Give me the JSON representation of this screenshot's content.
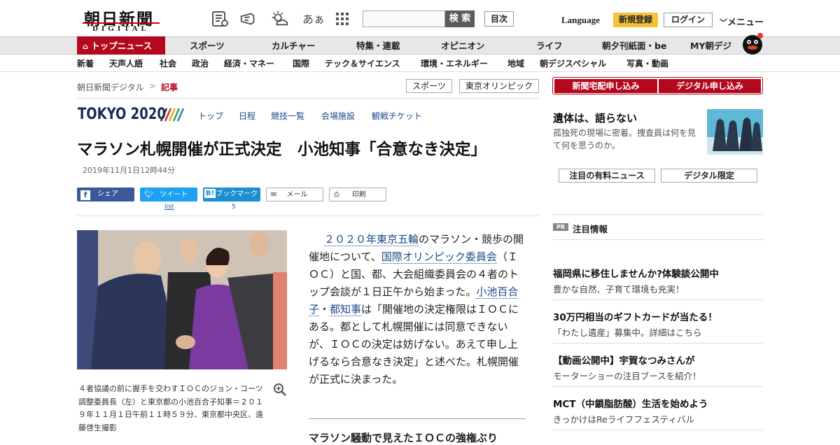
{
  "header": {
    "logo_main": "朝日新聞",
    "logo_sub": "DIGITAL",
    "search_placeholder": "",
    "search_button": "検 索",
    "index_button": "目次",
    "language": "Language",
    "register": "新規登録",
    "login": "ログイン",
    "menu": "メニュー",
    "aa_label": "あぁ"
  },
  "nav": {
    "items": [
      "トップニュース",
      "スポーツ",
      "カルチャー",
      "特集・連載",
      "オピニオン",
      "ライフ",
      "朝夕刊紙面・be",
      "MY朝デジ"
    ]
  },
  "subnav": {
    "items": [
      "新着",
      "天声人語",
      "社会",
      "政治",
      "経済・マネー",
      "国際",
      "テック＆サイエンス",
      "環境・エネルギー",
      "地域",
      "朝デジスペシャル",
      "写真・動画"
    ]
  },
  "breadcrumb": {
    "home": "朝日新聞デジタル",
    "sep": ">",
    "current": "記事"
  },
  "tags": [
    "スポーツ",
    "東京オリンピック"
  ],
  "tokyo": {
    "logo": "TOKYO 2020",
    "nav": [
      "トップ",
      "日程",
      "競技一覧",
      "会場施設",
      "観戦チケット"
    ]
  },
  "article": {
    "headline": "マラソン札幌開催が正式決定　小池知事「合意なき決定」",
    "date": "2019年11月1日12時44分",
    "share": {
      "facebook": "シェア",
      "twitter": "ツイート",
      "twitter_count": "list",
      "hatena_prefix": "B!",
      "hatena": "ブックマーク",
      "hatena_count": "5",
      "mail": "メール",
      "print": "印刷"
    },
    "caption": "４者協議の前に握手を交わすＩＯＣのジョン・コーツ調整委員長（左）と東京都の小池百合子知事＝２０１９年１１月１日午前１１時５９分、東京都中央区、遠藤啓生撮影",
    "body": {
      "link1": "２０２０年東京五輪",
      "text1": "のマラソン・競歩の開催地について、",
      "link2": "国際オリンピック委員会",
      "text2": "（ＩＯＣ）と国、都、大会組織委員会の４者のトップ会談が１日正午から始まった。",
      "link3": "小池百合子",
      "text3": "・",
      "link4": "都知事",
      "text4": "は「開催地の決定権限はＩＯＣにある。都として札幌開催には同意できないが、ＩＯＣの決定は妨げない。あえて申し上げるなら合意なき決定」と述べた。札幌開催が正式に決まった。"
    },
    "related": "マラソン騒動で見えたＩＯＣの強権ぶり"
  },
  "sidebar": {
    "subscribe_paper": "新聞宅配申し込み",
    "subscribe_digital": "デジタル申し込み",
    "feature_title": "遺体は、語らない",
    "feature_desc": "孤独死の現場に密着。捜査員は何を見て何を思うのか。",
    "tab_paid": "注目の有料ニュース",
    "tab_digital": "デジタル限定",
    "pr_badge": "PR",
    "pr_title": "注目情報",
    "pr_items": [
      {
        "title": "福岡県に移住しませんか?体験談公開中",
        "desc": "豊かな自然、子育て環境も充実！"
      },
      {
        "title": "30万円相当のギフトカードが当たる！",
        "desc": "「わたし遺産」募集中。詳細はこちら"
      },
      {
        "title": "【動画公開中】宇賀なつみさんが",
        "desc": "モーターショーの注目ブースを紹介！"
      },
      {
        "title": "MCT（中鎖脂肪酸）生活を始めよう",
        "desc": "きっかけはReライフフェスティバル"
      }
    ]
  },
  "colors": {
    "accent": "#b3081d",
    "facebook": "#3b5998",
    "twitter": "#1da1f2",
    "hatena": "#1b8fd0",
    "tokyo_navy": "#1a2a57"
  }
}
